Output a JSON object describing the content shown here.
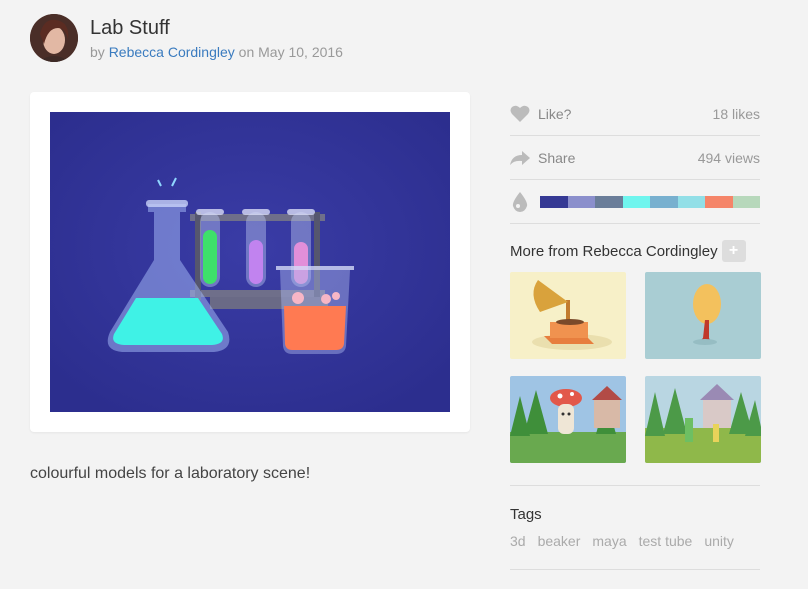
{
  "post": {
    "title": "Lab Stuff",
    "by_label": "by",
    "author": "Rebecca Cordingley",
    "on_label": "on",
    "date": "May 10, 2016",
    "description": "colourful models for a laboratory scene!"
  },
  "sidebar": {
    "like_label": "Like?",
    "likes": "18 likes",
    "share_label": "Share",
    "views": "494 views",
    "palette": [
      "#353994",
      "#8b8fcc",
      "#6a7d99",
      "#6ff5ee",
      "#78b0cf",
      "#92dfe7",
      "#f58569",
      "#b7d8bb"
    ],
    "more_from": "More from Rebecca Cordingley",
    "more_button": "+",
    "thumbnails": [
      "gramophone",
      "autumn-tree",
      "mushroom-character",
      "forest-house"
    ],
    "tags_title": "Tags",
    "tags": [
      "3d",
      "beaker",
      "maya",
      "test tube",
      "unity"
    ]
  },
  "colors": {
    "link": "#3a7bbf",
    "background": "#f3f3f3",
    "art_background": "#2f3196"
  }
}
